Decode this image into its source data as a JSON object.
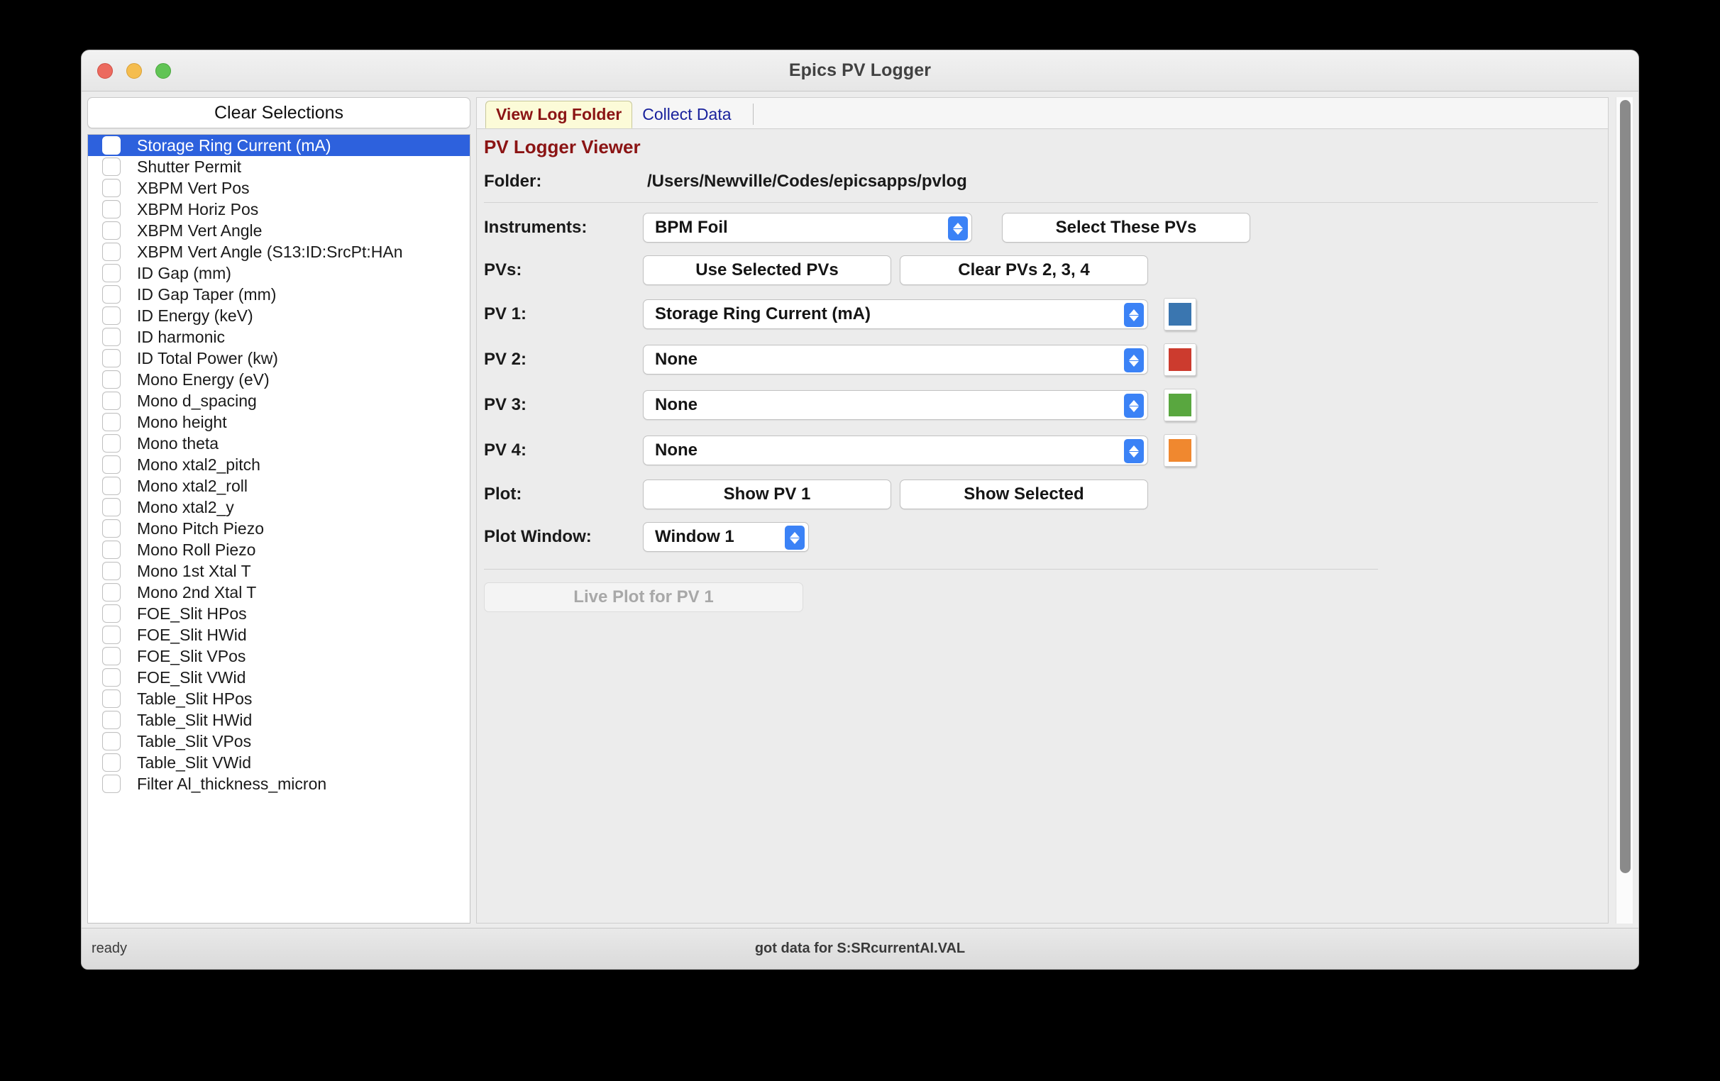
{
  "window": {
    "title": "Epics PV Logger",
    "traffic_lights": [
      "close-button",
      "minimize-button",
      "zoom-button"
    ]
  },
  "sidebar": {
    "clear_button": "Clear Selections",
    "items": [
      {
        "label": "Storage Ring Current (mA)",
        "selected": true
      },
      {
        "label": "Shutter Permit",
        "selected": false
      },
      {
        "label": "XBPM Vert Pos",
        "selected": false
      },
      {
        "label": "XBPM Horiz Pos",
        "selected": false
      },
      {
        "label": "XBPM Vert Angle",
        "selected": false
      },
      {
        "label": "XBPM Vert Angle (S13:ID:SrcPt:HAn",
        "selected": false
      },
      {
        "label": "ID Gap (mm)",
        "selected": false
      },
      {
        "label": "ID Gap Taper (mm)",
        "selected": false
      },
      {
        "label": "ID Energy (keV)",
        "selected": false
      },
      {
        "label": "ID harmonic",
        "selected": false
      },
      {
        "label": "ID Total Power (kw)",
        "selected": false
      },
      {
        "label": "Mono Energy (eV)",
        "selected": false
      },
      {
        "label": "Mono d_spacing",
        "selected": false
      },
      {
        "label": "Mono height",
        "selected": false
      },
      {
        "label": "Mono theta",
        "selected": false
      },
      {
        "label": "Mono xtal2_pitch",
        "selected": false
      },
      {
        "label": "Mono xtal2_roll",
        "selected": false
      },
      {
        "label": "Mono xtal2_y",
        "selected": false
      },
      {
        "label": "Mono Pitch Piezo",
        "selected": false
      },
      {
        "label": "Mono Roll Piezo",
        "selected": false
      },
      {
        "label": "Mono 1st Xtal T",
        "selected": false
      },
      {
        "label": "Mono 2nd Xtal T",
        "selected": false
      },
      {
        "label": "FOE_Slit HPos",
        "selected": false
      },
      {
        "label": "FOE_Slit HWid",
        "selected": false
      },
      {
        "label": "FOE_Slit VPos",
        "selected": false
      },
      {
        "label": "FOE_Slit VWid",
        "selected": false
      },
      {
        "label": "Table_Slit HPos",
        "selected": false
      },
      {
        "label": "Table_Slit HWid",
        "selected": false
      },
      {
        "label": "Table_Slit VPos",
        "selected": false
      },
      {
        "label": "Table_Slit VWid",
        "selected": false
      },
      {
        "label": "Filter Al_thickness_micron",
        "selected": false
      }
    ]
  },
  "tabs": [
    {
      "label": "View Log Folder",
      "active": true
    },
    {
      "label": "Collect Data",
      "active": false
    }
  ],
  "main": {
    "heading": "PV Logger Viewer",
    "folder_label": "Folder:",
    "folder_path": "/Users/Newville/Codes/epicsapps/pvlog",
    "instruments_label": "Instruments:",
    "instruments_value": "BPM Foil",
    "select_these_pvs": "Select These PVs",
    "pvs_label": "PVs:",
    "use_selected_pvs": "Use Selected PVs",
    "clear_pvs": "Clear PVs 2, 3, 4",
    "pv_rows": [
      {
        "label": "PV 1:",
        "value": "Storage Ring Current (mA)",
        "color": "#3a76b0"
      },
      {
        "label": "PV 2:",
        "value": "None",
        "color": "#cc3b2e"
      },
      {
        "label": "PV 3:",
        "value": "None",
        "color": "#59a73f"
      },
      {
        "label": "PV 4:",
        "value": "None",
        "color": "#f0882f"
      }
    ],
    "plot_label": "Plot:",
    "show_pv1": "Show PV 1",
    "show_selected": "Show Selected",
    "plot_window_label": "Plot Window:",
    "plot_window_value": "Window 1",
    "live_plot_button": "Live Plot for PV 1"
  },
  "statusbar": {
    "left": "ready",
    "center": "got data for S:SRcurrentAI.VAL"
  },
  "colors": {
    "accent_blue": "#3b82f6",
    "selection_blue": "#2d61dd",
    "heading_red": "#8b1414",
    "tab_active_bg": "#fcfbd8",
    "tab_inactive_text": "#19219c"
  }
}
